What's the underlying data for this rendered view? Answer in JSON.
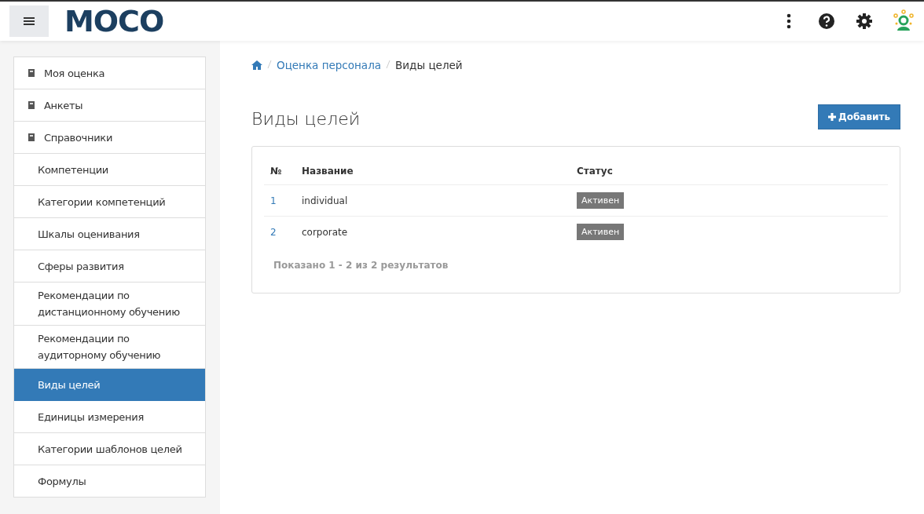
{
  "header": {
    "logo": "MOCO"
  },
  "sidebar": {
    "items": [
      {
        "label": "Моя оценка",
        "kind": "section",
        "selected": false
      },
      {
        "label": "Анкеты",
        "kind": "section",
        "selected": false
      },
      {
        "label": "Справочники",
        "kind": "section",
        "selected": false
      },
      {
        "label": "Компетенции",
        "kind": "sub",
        "selected": false
      },
      {
        "label": "Категории компетенций",
        "kind": "sub",
        "selected": false
      },
      {
        "label": "Шкалы оценивания",
        "kind": "sub",
        "selected": false
      },
      {
        "label": "Сферы развития",
        "kind": "sub",
        "selected": false
      },
      {
        "label": "Рекомендации по дистанционному обучению",
        "kind": "sub",
        "selected": false
      },
      {
        "label": "Рекомендации по аудиторному обучению",
        "kind": "sub",
        "selected": false
      },
      {
        "label": "Виды целей",
        "kind": "sub",
        "selected": true
      },
      {
        "label": "Единицы измерения",
        "kind": "sub",
        "selected": false
      },
      {
        "label": "Категории шаблонов целей",
        "kind": "sub",
        "selected": false
      },
      {
        "label": "Формулы",
        "kind": "sub",
        "selected": false
      }
    ]
  },
  "breadcrumb": [
    "Оценка персонала",
    "Виды целей"
  ],
  "page_title": "Виды целей",
  "add_button": "Добавить",
  "table": {
    "columns": [
      "№",
      "Название",
      "Статус"
    ],
    "rows": [
      {
        "number": "1",
        "name": "individual",
        "status": "Активен"
      },
      {
        "number": "2",
        "name": "corporate",
        "status": "Активен"
      }
    ]
  },
  "summary": "Показано 1 - 2 из 2 результатов"
}
